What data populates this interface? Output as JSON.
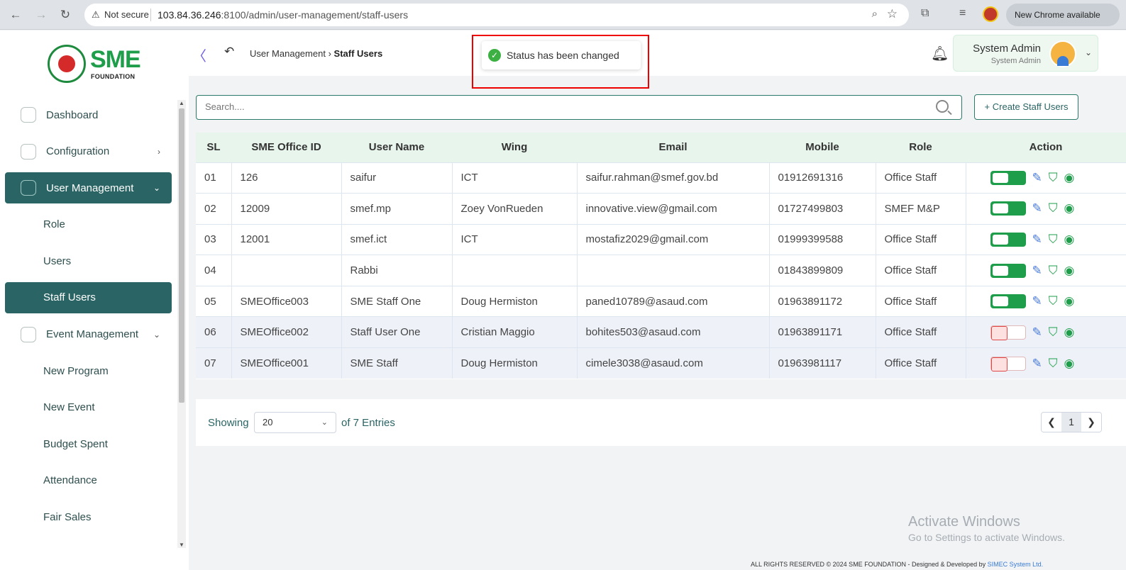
{
  "browser": {
    "not_secure": "Not secure",
    "url_host": "103.84.36.246",
    "url_rest": ":8100/admin/user-management/staff-users",
    "new_chrome": "New Chrome available"
  },
  "logo": {
    "text": "SME",
    "sub": "FOUNDATION"
  },
  "sidebar": {
    "items": [
      {
        "label": "Dashboard",
        "icon": "dashboard-icon"
      },
      {
        "label": "Configuration",
        "icon": "configuration-icon",
        "chevron": "›"
      },
      {
        "label": "User Management",
        "icon": "user-management-icon",
        "chevron": "⌄"
      },
      {
        "label": "Role"
      },
      {
        "label": "Users"
      },
      {
        "label": "Staff Users"
      },
      {
        "label": "Event Management",
        "icon": "event-management-icon",
        "chevron": "⌄"
      },
      {
        "label": "New Program"
      },
      {
        "label": "New Event"
      },
      {
        "label": "Budget Spent"
      },
      {
        "label": "Attendance"
      },
      {
        "label": "Fair Sales"
      }
    ]
  },
  "topbar": {
    "breadcrumb_parent": "User Management",
    "breadcrumb_current": "Staff Users",
    "user_name": "System Admin",
    "user_role": "System Admin"
  },
  "toast": {
    "message": "Status has been changed"
  },
  "search": {
    "placeholder": "Search...."
  },
  "create_button": "Create Staff Users",
  "table": {
    "headers": [
      "SL",
      "SME Office ID",
      "User Name",
      "Wing",
      "Email",
      "Mobile",
      "Role",
      "Action"
    ],
    "rows": [
      {
        "sl": "01",
        "office_id": "126",
        "user_name": "saifur",
        "wing": "ICT",
        "email": "saifur.rahman@smef.gov.bd",
        "mobile": "01912691316",
        "role": "Office Staff",
        "status": "on"
      },
      {
        "sl": "02",
        "office_id": "12009",
        "user_name": "smef.mp",
        "wing": "Zoey VonRueden",
        "email": "innovative.view@gmail.com",
        "mobile": "01727499803",
        "role": "SMEF M&P",
        "status": "on"
      },
      {
        "sl": "03",
        "office_id": "12001",
        "user_name": "smef.ict",
        "wing": "ICT",
        "email": "mostafiz2029@gmail.com",
        "mobile": "01999399588",
        "role": "Office Staff",
        "status": "on"
      },
      {
        "sl": "04",
        "office_id": "",
        "user_name": "Rabbi",
        "wing": "",
        "email": "",
        "mobile": "01843899809",
        "role": "Office Staff",
        "status": "on"
      },
      {
        "sl": "05",
        "office_id": "SMEOffice003",
        "user_name": "SME Staff One",
        "wing": "Doug Hermiston",
        "email": "paned10789@asaud.com",
        "mobile": "01963891172",
        "role": "Office Staff",
        "status": "on"
      },
      {
        "sl": "06",
        "office_id": "SMEOffice002",
        "user_name": "Staff User One",
        "wing": "Cristian Maggio",
        "email": "bohites503@asaud.com",
        "mobile": "01963891171",
        "role": "Office Staff",
        "status": "off"
      },
      {
        "sl": "07",
        "office_id": "SMEOffice001",
        "user_name": "SME Staff",
        "wing": "Doug Hermiston",
        "email": "cimele3038@asaud.com",
        "mobile": "01963981117",
        "role": "Office Staff",
        "status": "off"
      }
    ]
  },
  "pagination": {
    "showing": "Showing",
    "page_size": "20",
    "entries": "of 7 Entries",
    "current_page": "1"
  },
  "watermark": {
    "line1": "Activate Windows",
    "line2": "Go to Settings to activate Windows."
  },
  "footer": {
    "text": "ALL RIGHTS RESERVED © 2024 SME FOUNDATION - Designed & Developed by",
    "brand": "SIMEC System Ltd."
  },
  "colors": {
    "brand_teal": "#2a6464",
    "brand_green": "#1e9e4a",
    "toggle_off": "#e04848",
    "edit_blue": "#4a7bd8"
  }
}
